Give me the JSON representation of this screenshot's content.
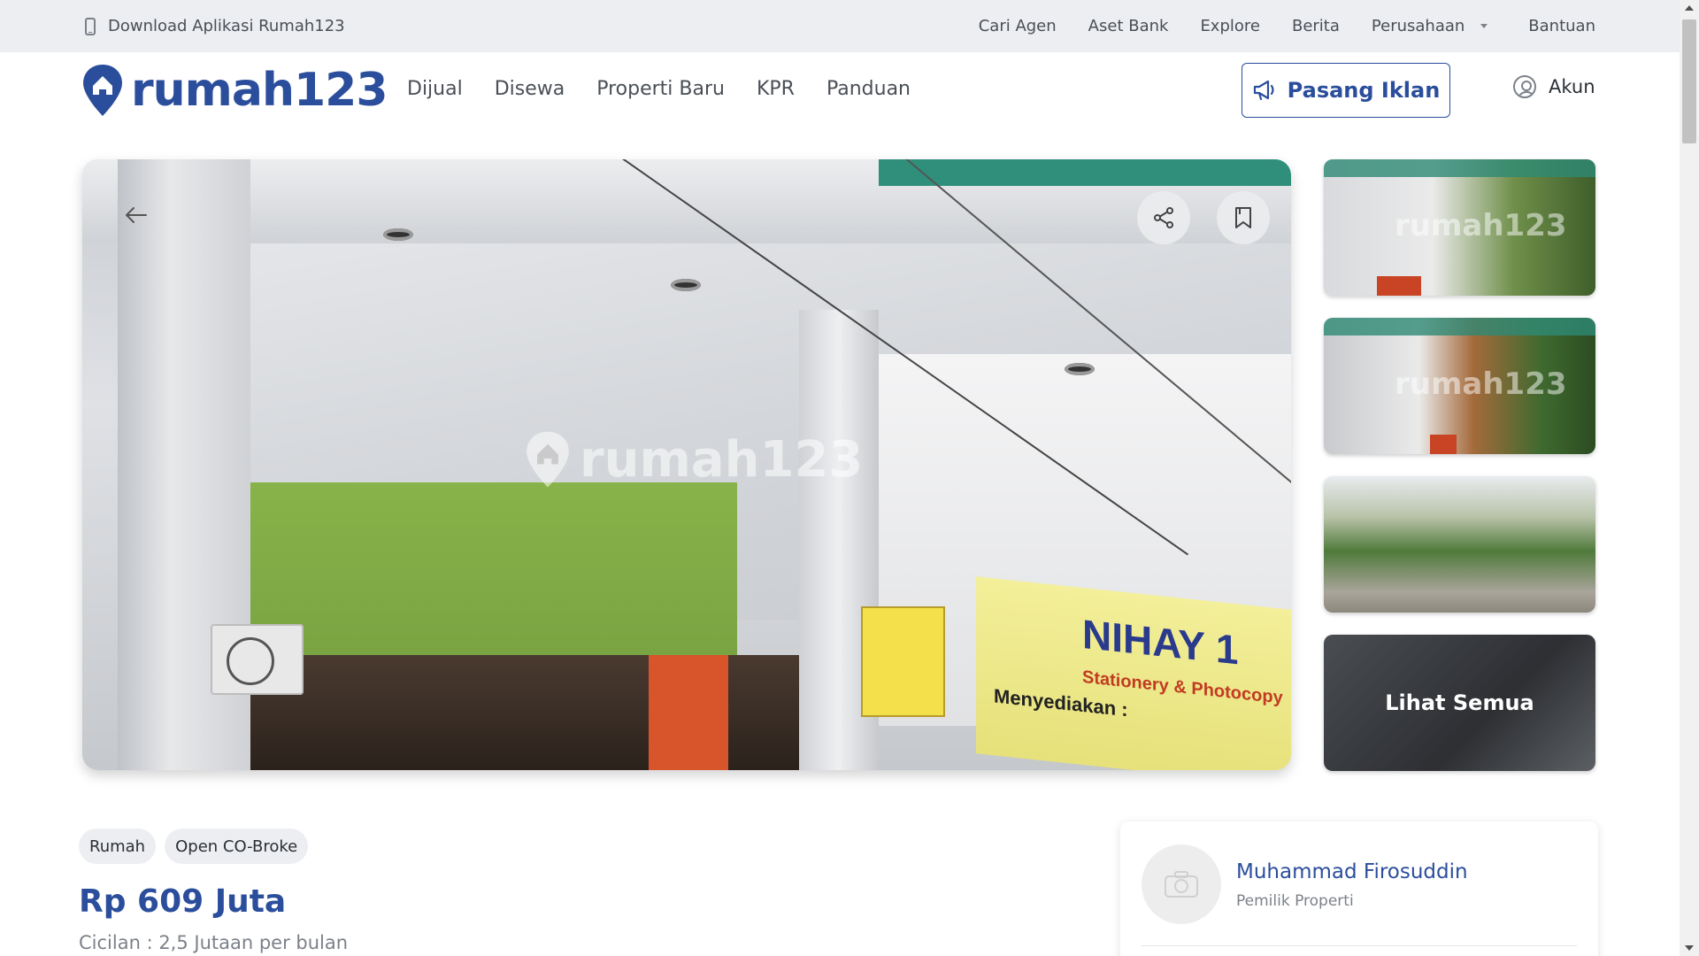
{
  "topbar": {
    "download_label": "Download Aplikasi Rumah123",
    "links": [
      "Cari Agen",
      "Aset Bank",
      "Explore",
      "Berita",
      "Perusahaan",
      "Bantuan"
    ]
  },
  "header": {
    "logo_text": "rumah123",
    "nav": [
      "Dijual",
      "Disewa",
      "Properti Baru",
      "KPR",
      "Panduan"
    ],
    "pasang_label": "Pasang Iklan",
    "akun_label": "Akun"
  },
  "gallery": {
    "watermark": "rumah123",
    "banner_title": "NIHAY 1",
    "banner_subtitle": "Stationery & Photocopy",
    "banner_text": "Menyediakan :",
    "thumb_watermark": "rumah123",
    "see_all_label": "Lihat Semua"
  },
  "listing": {
    "tags": [
      "Rumah",
      "Open CO-Broke"
    ],
    "price": "Rp 609 Juta",
    "cicilan": "Cicilan : 2,5 Jutaan per bulan"
  },
  "agent": {
    "name": "Muhammad Firosuddin",
    "role": "Pemilik Properti"
  },
  "colors": {
    "brand": "#2b4e9c",
    "topbar_bg": "#eceef1"
  }
}
